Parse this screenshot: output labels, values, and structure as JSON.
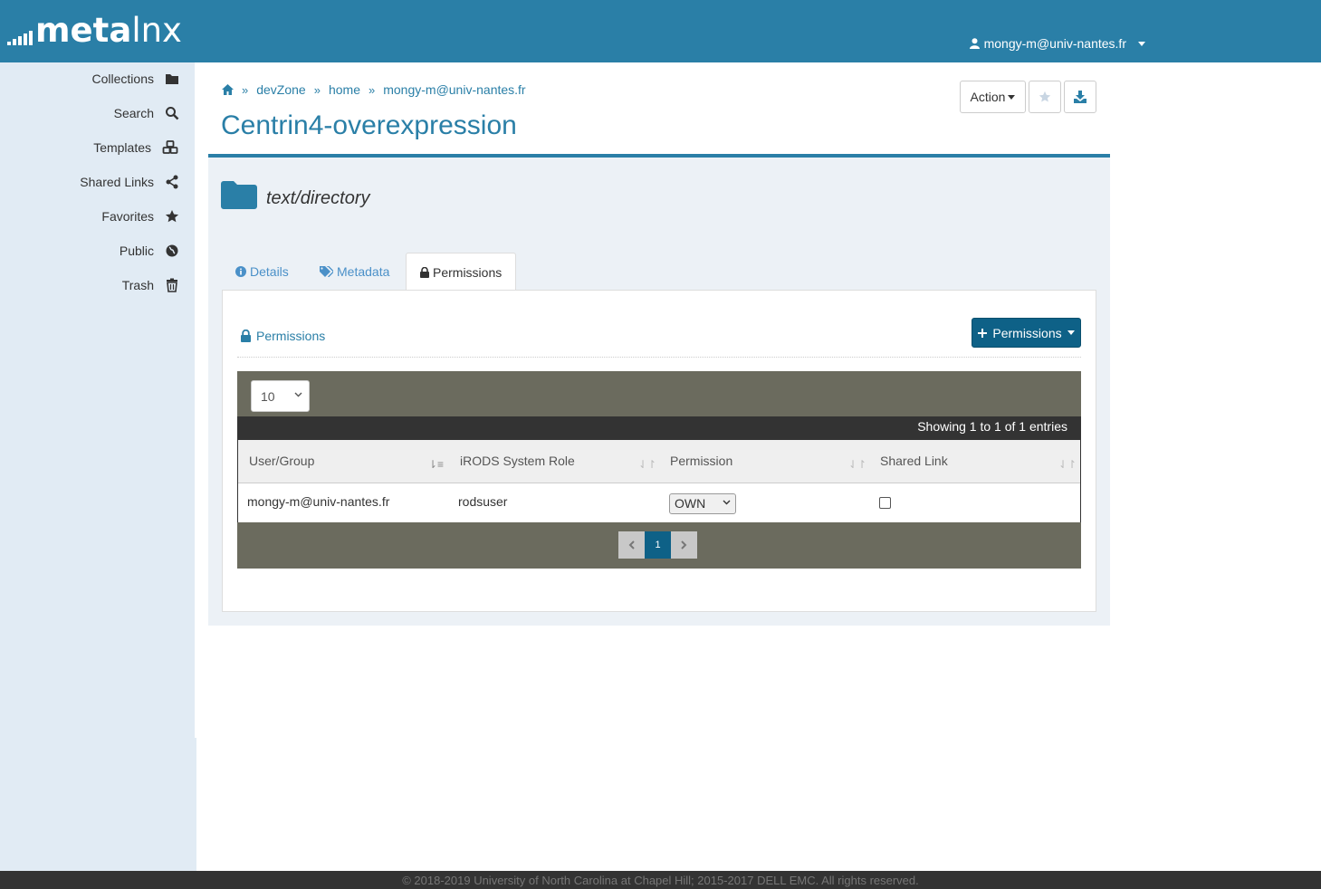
{
  "brand": {
    "name_bold": "meta",
    "name_light": "lnx",
    "logo_bars": [
      4,
      7,
      10,
      13,
      16
    ]
  },
  "header": {
    "user": "mongy-m@univ-nantes.fr"
  },
  "sidebar": {
    "items": [
      {
        "label": "Collections",
        "icon": "folder-icon"
      },
      {
        "label": "Search",
        "icon": "search-icon"
      },
      {
        "label": "Templates",
        "icon": "cubes-icon"
      },
      {
        "label": "Shared Links",
        "icon": "share-icon"
      },
      {
        "label": "Favorites",
        "icon": "star-icon"
      },
      {
        "label": "Public",
        "icon": "globe-icon"
      },
      {
        "label": "Trash",
        "icon": "trash-icon"
      }
    ]
  },
  "breadcrumb": {
    "home_icon": "home-icon",
    "items": [
      "devZone",
      "home",
      "mongy-m@univ-nantes.fr"
    ]
  },
  "page": {
    "title": "Centrin4-overexpression",
    "mime_type": "text/directory"
  },
  "toolbar": {
    "action_label": "Action",
    "star_icon": "star-icon",
    "download_icon": "download-icon"
  },
  "tabs": [
    {
      "label": "Details",
      "icon": "info-icon"
    },
    {
      "label": "Metadata",
      "icon": "tags-icon"
    },
    {
      "label": "Permissions",
      "icon": "lock-icon",
      "active": true
    }
  ],
  "permissions": {
    "heading": "Permissions",
    "add_button": "Permissions",
    "page_length": "10",
    "info": "Showing 1 to 1 of 1 entries",
    "columns": [
      "User/Group",
      "iRODS System Role",
      "Permission",
      "Shared Link"
    ],
    "rows": [
      {
        "user": "mongy-m@univ-nantes.fr",
        "role": "rodsuser",
        "permission": "OWN",
        "shared_link": false
      }
    ],
    "pagination": {
      "current": "1"
    }
  },
  "footer": {
    "text": "© 2018-2019 University of North Carolina at Chapel Hill; 2015-2017 DELL EMC. All rights reserved."
  },
  "colors": {
    "brand": "#2a7fa7",
    "primary_button": "#0e6187",
    "table_toolbar": "#6b6b5e",
    "sidebar_bg": "#e1ebf4"
  }
}
